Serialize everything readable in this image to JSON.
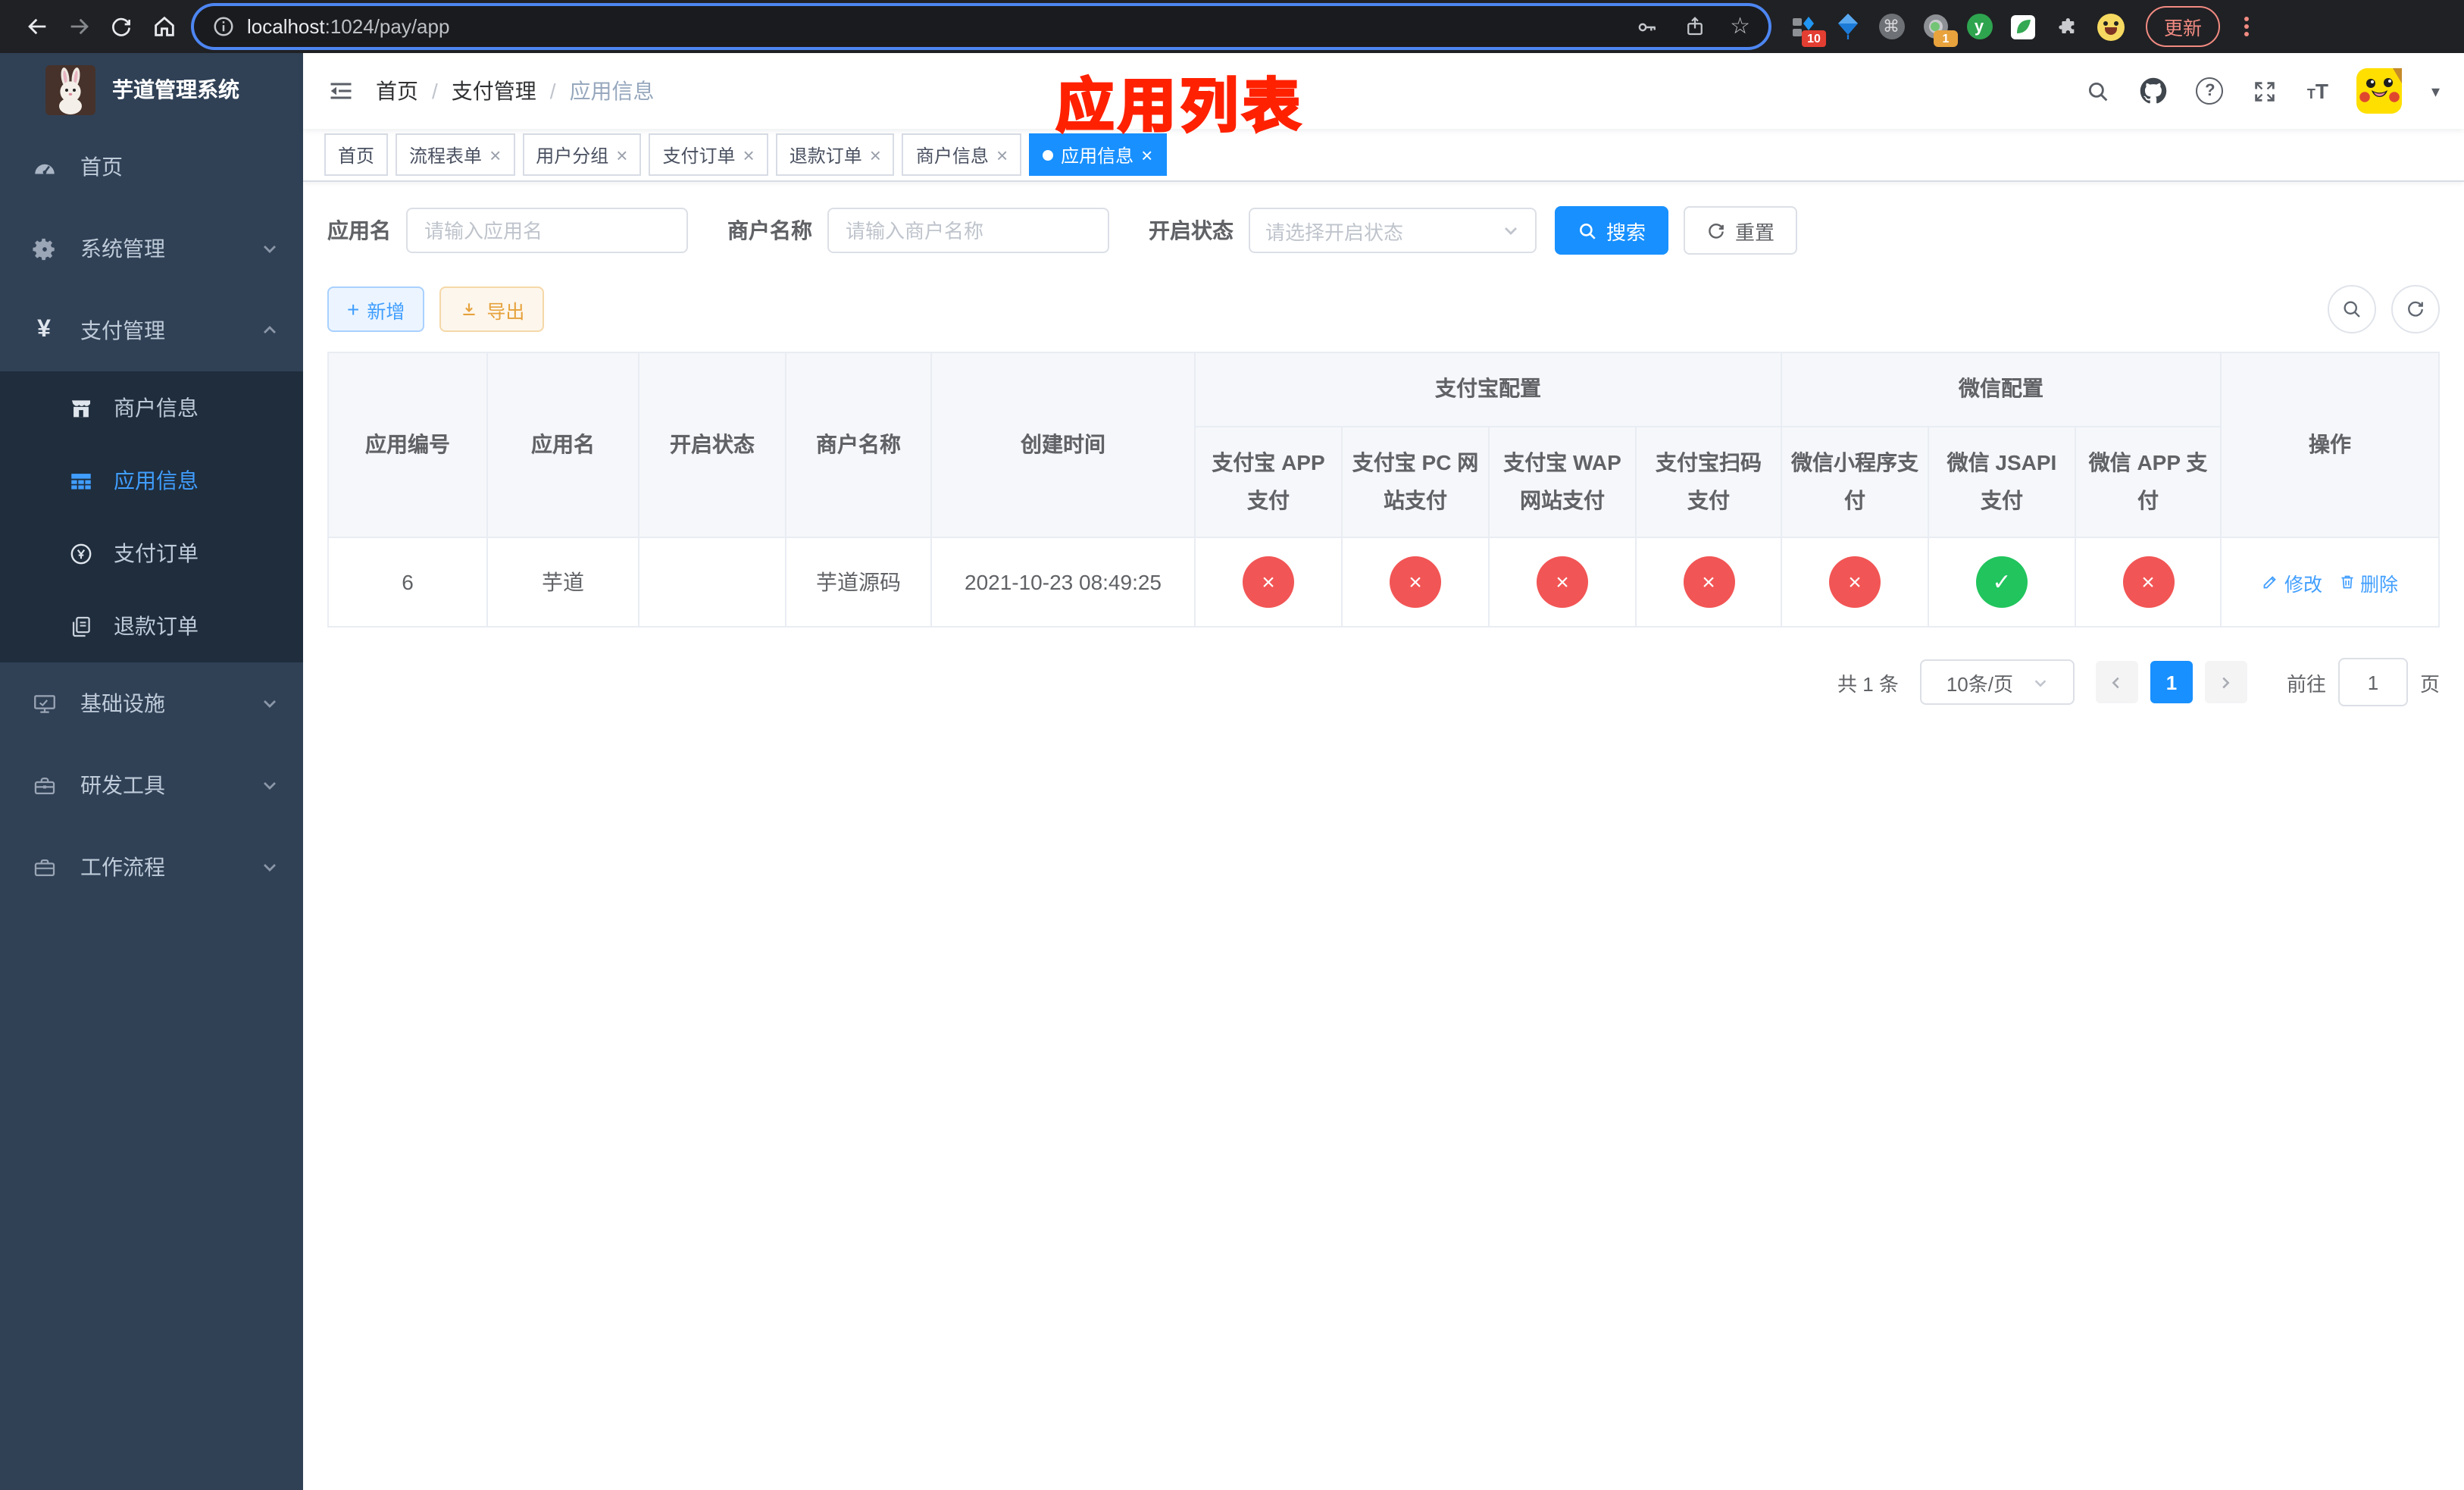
{
  "colors": {
    "primary": "#1890ff",
    "link": "#409eff",
    "success": "#21c45d",
    "danger": "#f25555",
    "warning": "#e6a23c",
    "sidebar_bg": "#304156",
    "submenu_bg": "#1f2d3d",
    "annotation": "#ff2100"
  },
  "browser": {
    "url_host": "localhost",
    "url_path": ":1024/pay/app",
    "update_label": "更新",
    "ext_badge_a": "10",
    "ext_badge_b": "1",
    "ext_y_glyph": "y",
    "cmd_glyph": "⌘",
    "star_glyph": "☆"
  },
  "sidebar": {
    "title": "芋道管理系统",
    "menu": [
      {
        "label": "首页"
      },
      {
        "label": "系统管理"
      },
      {
        "label": "支付管理"
      },
      {
        "label": "商户信息"
      },
      {
        "label": "应用信息"
      },
      {
        "label": "支付订单"
      },
      {
        "label": "退款订单"
      },
      {
        "label": "基础设施"
      },
      {
        "label": "研发工具"
      },
      {
        "label": "工作流程"
      }
    ]
  },
  "navbar": {
    "breadcrumb": [
      "首页",
      "支付管理",
      "应用信息"
    ],
    "separator": "/",
    "annotation": "应用列表",
    "help_glyph": "?"
  },
  "tabs": [
    {
      "label": "首页"
    },
    {
      "label": "流程表单"
    },
    {
      "label": "用户分组"
    },
    {
      "label": "支付订单"
    },
    {
      "label": "退款订单"
    },
    {
      "label": "商户信息"
    },
    {
      "label": "应用信息"
    }
  ],
  "filters": {
    "app_name_label": "应用名",
    "app_name_placeholder": "请输入应用名",
    "merchant_label": "商户名称",
    "merchant_placeholder": "请输入商户名称",
    "status_label": "开启状态",
    "status_placeholder": "请选择开启状态",
    "search_label": "搜索",
    "reset_label": "重置"
  },
  "toolbar": {
    "add_label": "新增",
    "export_label": "导出"
  },
  "table": {
    "simple_columns": [
      "应用编号",
      "应用名",
      "开启状态",
      "商户名称",
      "创建时间"
    ],
    "groups": [
      {
        "label": "支付宝配置",
        "children": [
          "支付宝 APP 支付",
          "支付宝 PC 网站支付",
          "支付宝 WAP 网站支付",
          "支付宝扫码支付"
        ]
      },
      {
        "label": "微信配置",
        "children": [
          "微信小程序支付",
          "微信 JSAPI 支付",
          "微信 APP 支付"
        ]
      }
    ],
    "op_column": "操作",
    "check_glyph": "✓",
    "cross_glyph": "×",
    "row": {
      "id": "6",
      "name": "芋道",
      "merchant": "芋道源码",
      "created": "2021-10-23 08:49:25",
      "enabled": true,
      "statuses": [
        "no",
        "no",
        "no",
        "no",
        "no",
        "ok",
        "no"
      ],
      "edit_label": "修改",
      "delete_label": "删除"
    }
  },
  "pagination": {
    "total": "共 1 条",
    "page_size": "10条/页",
    "current_page": "1",
    "goto_label": "前往",
    "goto_value": "1",
    "unit_label": "页"
  }
}
